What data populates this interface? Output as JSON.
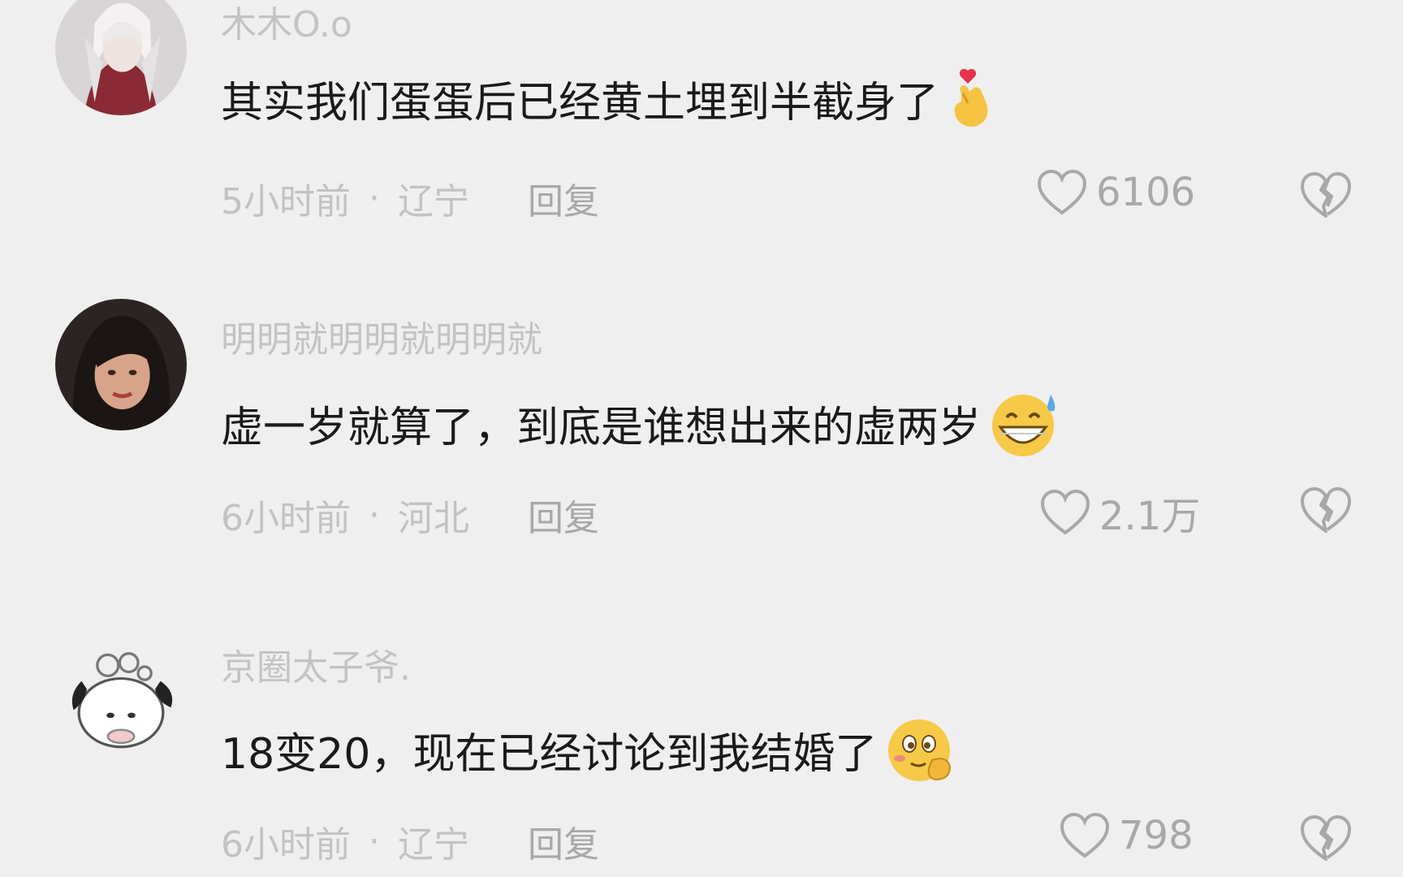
{
  "comments": [
    {
      "username": "木木O.o",
      "text": "其实我们蛋蛋后已经黄土埋到半截身了",
      "emoji_icon": "finger-heart-icon",
      "time": "5小时前",
      "separator": "·",
      "location": "辽宁",
      "reply_label": "回复",
      "likes": "6106"
    },
    {
      "username": "明明就明明就明明就",
      "text": "虚一岁就算了，到底是谁想出来的虚两岁",
      "emoji_icon": "grinning-sweat-icon",
      "time": "6小时前",
      "separator": "·",
      "location": "河北",
      "reply_label": "回复",
      "likes": "2.1万"
    },
    {
      "username": "京圈太子爷.",
      "text": "18变20，现在已经讨论到我结婚了",
      "emoji_icon": "thinking-shy-icon",
      "time": "6小时前",
      "separator": "·",
      "location": "辽宁",
      "reply_label": "回复",
      "likes": "798"
    }
  ],
  "colors": {
    "background": "#efefef",
    "text_primary": "#1a1a1a",
    "text_secondary": "#c2c2c2",
    "icon": "#a8a8a8"
  }
}
